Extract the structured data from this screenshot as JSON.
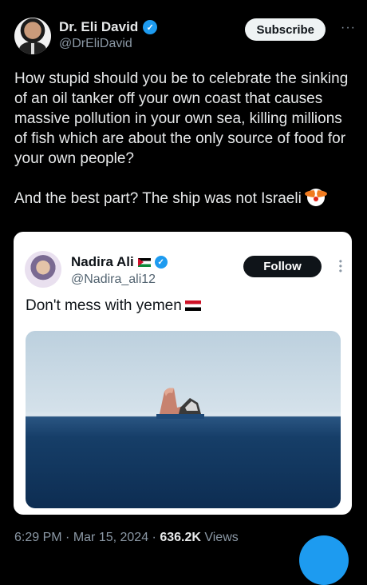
{
  "author": {
    "display_name": "Dr. Eli David",
    "handle": "@DrEliDavid",
    "verified_icon": "verified-badge-icon"
  },
  "actions": {
    "subscribe_label": "Subscribe",
    "more_label": "···"
  },
  "tweet": {
    "paragraph_1": "How stupid should you be to celebrate the sinking of an oil tanker off your own coast that causes massive pollution in your own sea, killing millions of fish which are about the only source of food for your own people?",
    "paragraph_2": "And the best part? The ship was not Israeli",
    "emoji_icon": "clown-face-icon"
  },
  "quoted_tweet": {
    "display_name": "Nadira Ali",
    "flag_icon": "palestine-flag-icon",
    "handle": "@Nadira_ali12",
    "follow_label": "Follow",
    "text": "Don't mess with yemen",
    "text_flag_icon": "yemen-flag-icon",
    "image_icon": "sinking-ship-photo"
  },
  "meta": {
    "time": "6:29 PM",
    "sep1": " · ",
    "date": "Mar 15, 2024",
    "sep2": " · ",
    "views_count": "636.2K",
    "views_label": " Views"
  },
  "colors": {
    "background": "#000000",
    "accent": "#1d9bf0",
    "text": "#e7e9ea",
    "muted": "#8b98a5"
  }
}
